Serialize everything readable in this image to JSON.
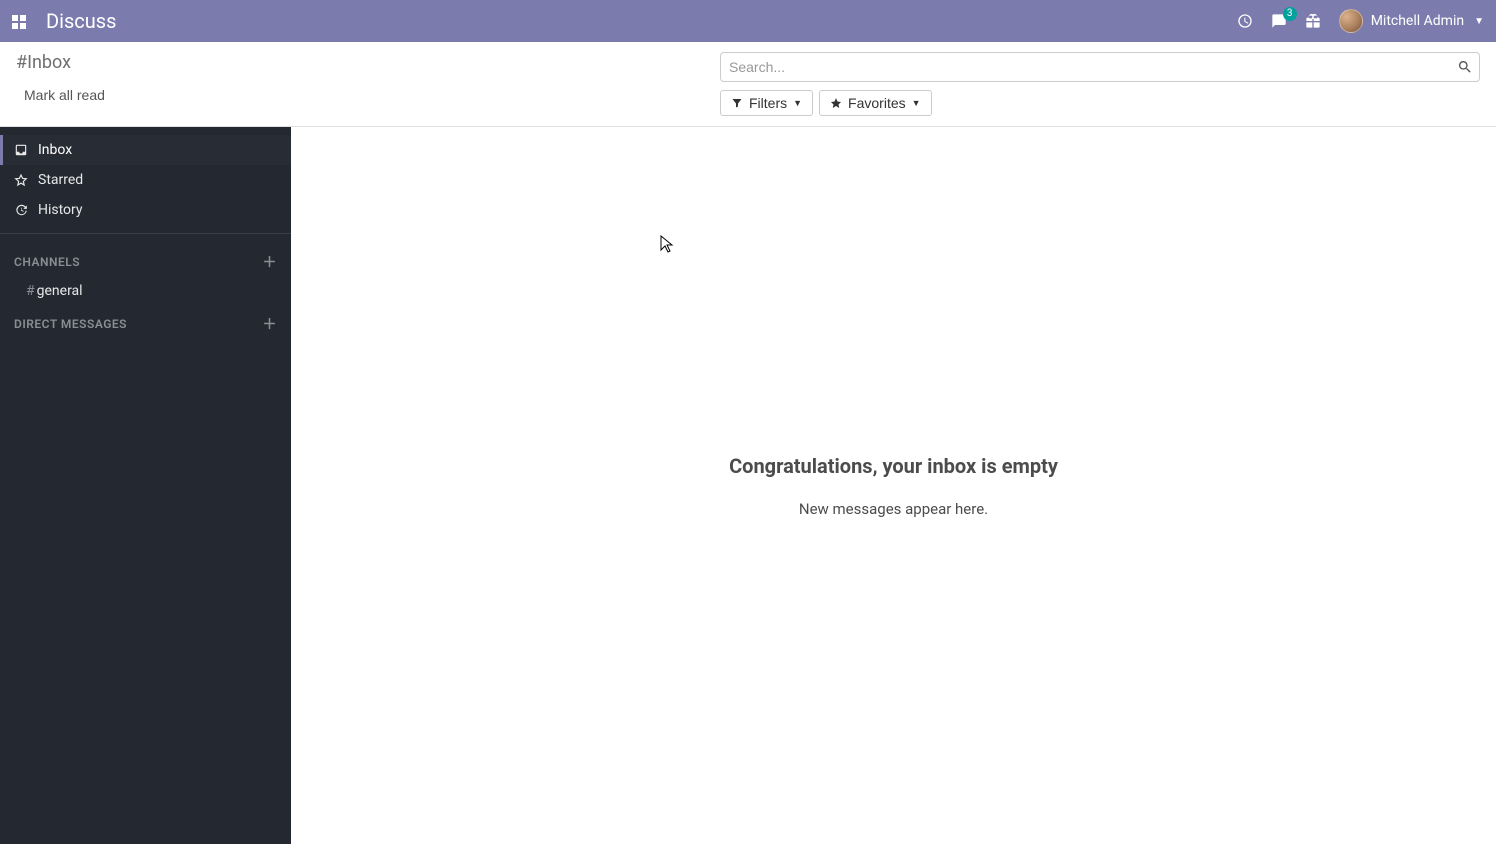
{
  "navbar": {
    "app_title": "Discuss",
    "messages_badge": "3",
    "user_name": "Mitchell Admin"
  },
  "control_panel": {
    "breadcrumb": "#Inbox",
    "mark_all_read": "Mark all read",
    "search_placeholder": "Search...",
    "filters_label": "Filters",
    "favorites_label": "Favorites"
  },
  "sidebar": {
    "items": [
      {
        "label": "Inbox"
      },
      {
        "label": "Starred"
      },
      {
        "label": "History"
      }
    ],
    "sections": {
      "channels_header": "CHANNELS",
      "direct_messages_header": "DIRECT MESSAGES"
    },
    "channels": [
      {
        "name": "general"
      }
    ]
  },
  "main": {
    "empty_title": "Congratulations, your inbox is empty",
    "empty_subtitle": "New messages appear here."
  }
}
